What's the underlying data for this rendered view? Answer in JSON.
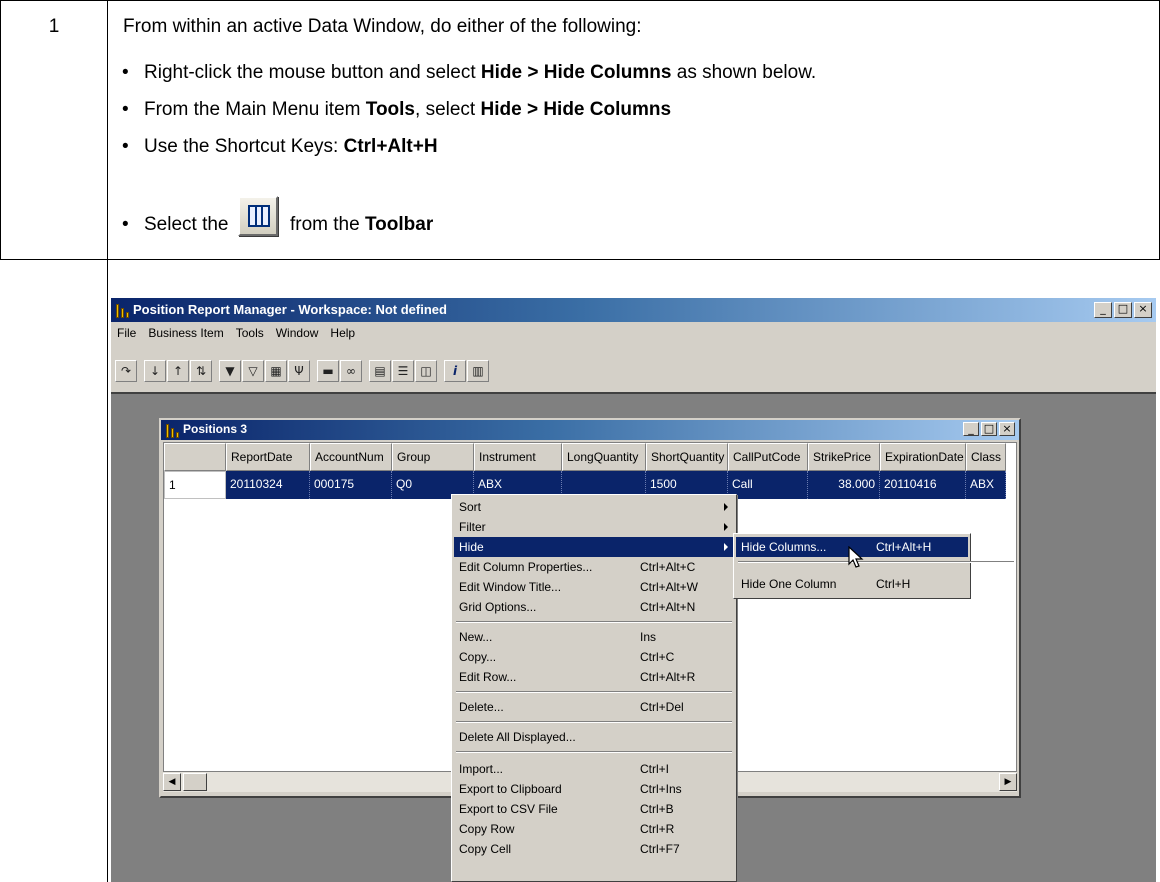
{
  "step": {
    "number": "1",
    "intro": "From within an active Data Window, do either of the following:",
    "bullets": [
      {
        "pre": "Right-click the mouse button and select ",
        "bold": "Hide > Hide Columns",
        "post": " as shown below."
      },
      {
        "pre": "From the Main Menu item ",
        "bold": "Tools",
        "mid": ", select ",
        "bold2": "Hide > Hide Columns"
      },
      {
        "pre": "Use the Shortcut Keys: ",
        "bold": "Ctrl+Alt+H"
      },
      {
        "pre": "Select the",
        "post": "from the ",
        "bold": "Toolbar",
        "icon": "hide-columns-icon"
      }
    ]
  },
  "app": {
    "title": "Position Report Manager - Workspace: Not defined",
    "menu": [
      "File",
      "Business Item",
      "Tools",
      "Window",
      "Help"
    ],
    "window_buttons": {
      "minimize": "_",
      "maximize": "□",
      "close": "×"
    }
  },
  "child": {
    "title": "Positions 3",
    "columns": [
      "",
      "ReportDate",
      "AccountNum",
      "Group",
      "Instrument",
      "LongQuantity",
      "ShortQuantity",
      "CallPutCode",
      "StrikePrice",
      "ExpirationDate",
      "Class"
    ],
    "row": [
      "1",
      "20110324",
      "000175",
      "Q0",
      "ABX",
      "",
      "1500",
      "Call",
      "38.000",
      "20110416",
      "ABX"
    ]
  },
  "context_menu": {
    "items": [
      {
        "label": "Sort",
        "shortcut": "",
        "submenu": true
      },
      {
        "label": "Filter",
        "shortcut": "",
        "submenu": true
      },
      {
        "label": "Hide",
        "shortcut": "",
        "submenu": true,
        "highlighted": true
      },
      {
        "label": "Edit Column Properties...",
        "shortcut": "Ctrl+Alt+C"
      },
      {
        "label": "Edit Window Title...",
        "shortcut": "Ctrl+Alt+W"
      },
      {
        "label": "Grid Options...",
        "shortcut": "Ctrl+Alt+N"
      },
      {
        "label": "New...",
        "shortcut": "Ins"
      },
      {
        "label": "Copy...",
        "shortcut": "Ctrl+C"
      },
      {
        "label": "Edit Row...",
        "shortcut": "Ctrl+Alt+R"
      },
      {
        "label": "Delete...",
        "shortcut": "Ctrl+Del"
      },
      {
        "label": "Delete All Displayed...",
        "shortcut": ""
      },
      {
        "label": "Import...",
        "shortcut": "Ctrl+I"
      },
      {
        "label": "Export to Clipboard",
        "shortcut": "Ctrl+Ins"
      },
      {
        "label": "Export to CSV File",
        "shortcut": "Ctrl+B"
      },
      {
        "label": "Copy Row",
        "shortcut": "Ctrl+R"
      },
      {
        "label": "Copy Cell",
        "shortcut": "Ctrl+F7"
      }
    ],
    "submenu": [
      {
        "label": "Hide Columns...",
        "shortcut": "Ctrl+Alt+H",
        "highlighted": true
      },
      {
        "label": "Hide One Column",
        "shortcut": "Ctrl+H"
      }
    ]
  },
  "colors": {
    "title_active": "#0a246a",
    "face": "#d4d0c8",
    "workspace": "#808080"
  }
}
